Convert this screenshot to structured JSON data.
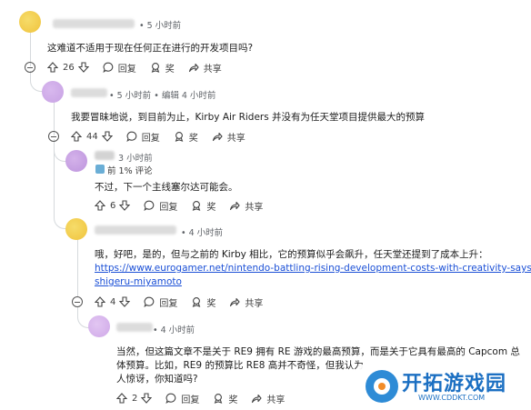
{
  "comments": [
    {
      "meta": "• 5 小时前",
      "text": "这难道不适用于现在任何正在进行的开发项目吗?",
      "votes": "26",
      "reply": "回复",
      "award": "奖",
      "share": "共享"
    },
    {
      "meta": "• 5 小时前 • 编辑 4 小时前",
      "text": "我要冒昧地说，到目前为止，Kirby Air Riders 并没有为任天堂项目提供最大的预算",
      "votes": "44",
      "reply": "回复",
      "award": "奖",
      "share": "共享"
    },
    {
      "meta": "3 小时前",
      "flair": "前 1% 评论",
      "text": "不过，下一个主线塞尔达可能会。",
      "votes": "6",
      "reply": "回复",
      "award": "奖",
      "share": "共享"
    },
    {
      "meta": "• 4 小时前",
      "text_line1": "哦，好吧，是的，但与之前的 Kirby 相比，它的预算似乎会飙升，任天堂还提到了成本上升：",
      "link_line1": "https://www.eurogamer.net/nintendo-battling-rising-development-costs-with-creativity-says-",
      "link_line2": "shigeru-miyamoto",
      "votes": "4",
      "reply": "回复",
      "award": "奖",
      "share": "共享"
    },
    {
      "meta": "• 4 小时前",
      "text_line1": "当然，但这篇文章不是关于 RE9 拥有 RE 游戏的最高预算，而是关于它具有最高的 Capcom 总",
      "text_line2": "体预算。比如，RE9 的预算比 RE8 高并不奇怪，但我认为",
      "text_line3": "人惊讶，你知道吗?",
      "votes": "2",
      "reply": "回复",
      "award": "奖",
      "share": "共享"
    }
  ],
  "watermark": {
    "title": "开拓游戏园",
    "url": "WWW.CDDKT.COM"
  },
  "colors": {
    "link": "#1a4fd6",
    "thread_line": "#d5d9dc",
    "meta": "#5f6368"
  }
}
